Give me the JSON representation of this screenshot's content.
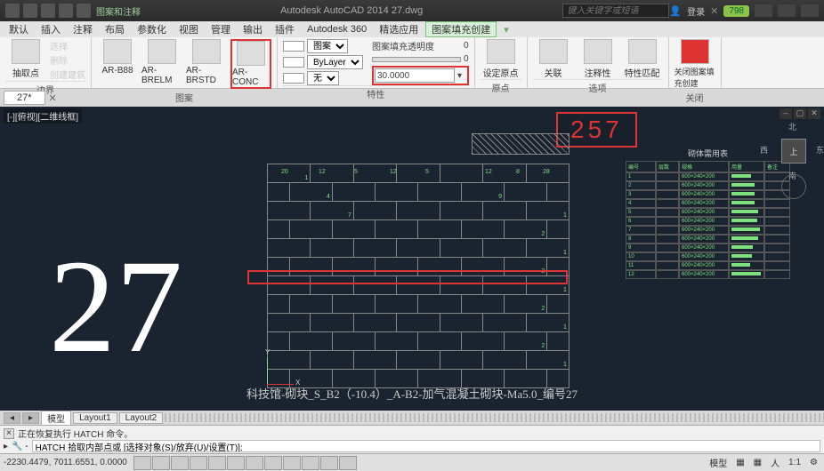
{
  "title": "Autodesk AutoCAD 2014    27.dwg",
  "title_hint": "图案和注释",
  "search_placeholder": "键入关键字或短语",
  "user": "登录",
  "badge": "798",
  "menu": [
    "默认",
    "插入",
    "注释",
    "布局",
    "参数化",
    "视图",
    "管理",
    "输出",
    "插件",
    "Autodesk 360",
    "精选应用",
    "图案填充创建"
  ],
  "ribbon": {
    "panel1": {
      "btn": "抽取点",
      "opts": [
        "选择",
        "删除",
        "创建建筑"
      ],
      "label": "边界"
    },
    "panel2": {
      "btns": [
        "AR-B88",
        "AR-BRELM",
        "AR-BRSTD",
        "AR-CONC"
      ],
      "label": "图案"
    },
    "panel3": {
      "row1": "图案",
      "row2": "ByLayer",
      "row3": "无",
      "num": "30.0000",
      "trans_label": "图案填充透明度",
      "trans_val": "0",
      "label": "特性"
    },
    "panel4": {
      "b1": "设定原点",
      "label": "原点"
    },
    "panel5": {
      "b1": "关联",
      "b2": "注释性",
      "b3": "特性匹配",
      "label": "选项"
    },
    "panel6": {
      "b1": "关闭图案填充创建",
      "label": "关闭"
    }
  },
  "filetab": "27*",
  "canvas_title": "[-][俯视][二维线框]",
  "big_number": "27",
  "callout_number": "257",
  "dims_top": [
    "20",
    "12",
    "5",
    "12",
    "5",
    "12",
    "8",
    "28"
  ],
  "compass": {
    "n": "北",
    "s": "南",
    "e": "东",
    "w": "西",
    "top": "上"
  },
  "axis": {
    "x": "X",
    "y": "Y"
  },
  "table": {
    "title": "砌体需用表",
    "headers": [
      "编号",
      "层数",
      "规格",
      "用量",
      "备注"
    ],
    "rows": [
      [
        "1",
        "",
        "600×240×200",
        "",
        ""
      ],
      [
        "2",
        "",
        "600×240×200",
        "",
        ""
      ],
      [
        "3",
        "",
        "600×240×200",
        "",
        ""
      ],
      [
        "4",
        "",
        "600×240×200",
        "",
        ""
      ],
      [
        "5",
        "",
        "600×240×200",
        "",
        ""
      ],
      [
        "6",
        "",
        "600×240×200",
        "",
        ""
      ],
      [
        "7",
        "",
        "600×240×200",
        "",
        ""
      ],
      [
        "8",
        "",
        "600×240×200",
        "",
        ""
      ],
      [
        "9",
        "",
        "600×240×200",
        "",
        ""
      ],
      [
        "10",
        "",
        "600×240×200",
        "",
        ""
      ],
      [
        "11",
        "",
        "600×240×200",
        "",
        ""
      ],
      [
        "12",
        "",
        "600×240×200",
        "",
        ""
      ]
    ]
  },
  "caption": "科技馆-砌块_S_B2（-10.4）_A-B2-加气混凝土砌块-Ma5.0_编号27",
  "model_tabs": [
    "模型",
    "Layout1",
    "Layout2"
  ],
  "cmd": {
    "history1": "正在恢复执行 HATCH 命令。",
    "prompt": "HATCH 拾取内部点或 [选择对象(S)/放弃(U)/设置(T)]:"
  },
  "status": {
    "coords": "-2230.4479, 7011.6551, 0.0000",
    "right": [
      "模型",
      "▦",
      "▦",
      "人",
      "1:1",
      "⚙"
    ]
  }
}
